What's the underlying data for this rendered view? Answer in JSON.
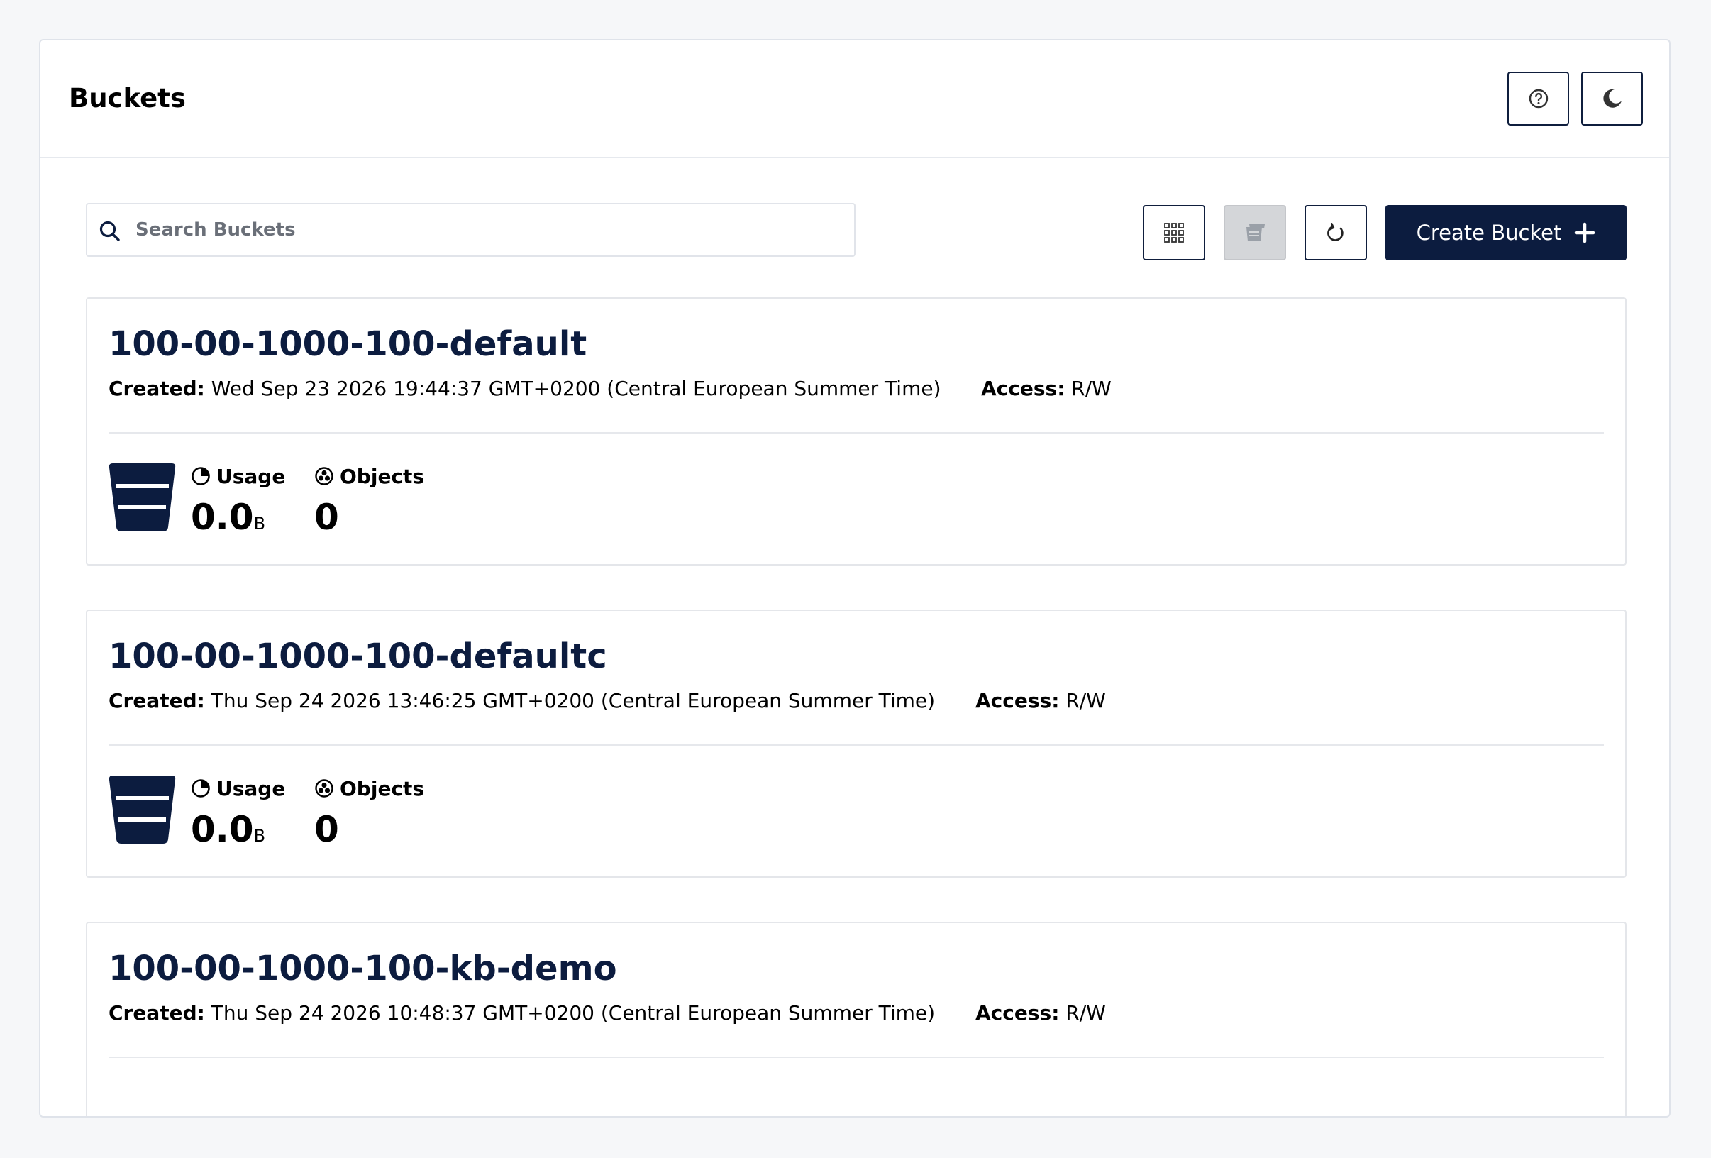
{
  "header": {
    "title": "Buckets",
    "help_icon": "help-circle-icon",
    "theme_icon": "moon-icon"
  },
  "toolbar": {
    "search_placeholder": "Search Buckets",
    "search_value": "",
    "grid_view_icon": "grid-view-icon",
    "list_view_icon": "list-view-icon",
    "refresh_icon": "refresh-icon",
    "create_label": "Create Bucket",
    "create_icon": "plus-icon"
  },
  "labels": {
    "created": "Created:",
    "access": "Access:",
    "usage": "Usage",
    "objects": "Objects"
  },
  "buckets": [
    {
      "name": "100-00-1000-100-default",
      "created": "Wed Sep 23 2026 19:44:37 GMT+0200 (Central European Summer Time)",
      "access": "R/W",
      "usage_value": "0.0",
      "usage_unit": "B",
      "objects": "0"
    },
    {
      "name": "100-00-1000-100-defaultc",
      "created": "Thu Sep 24 2026 13:46:25 GMT+0200 (Central European Summer Time)",
      "access": "R/W",
      "usage_value": "0.0",
      "usage_unit": "B",
      "objects": "0"
    },
    {
      "name": "100-00-1000-100-kb-demo",
      "created": "Thu Sep 24 2026 10:48:37 GMT+0200 (Central European Summer Time)",
      "access": "R/W"
    }
  ],
  "colors": {
    "brand": "#0c1c3f",
    "background": "#f6f7f9",
    "border": "#e4e6ea"
  }
}
